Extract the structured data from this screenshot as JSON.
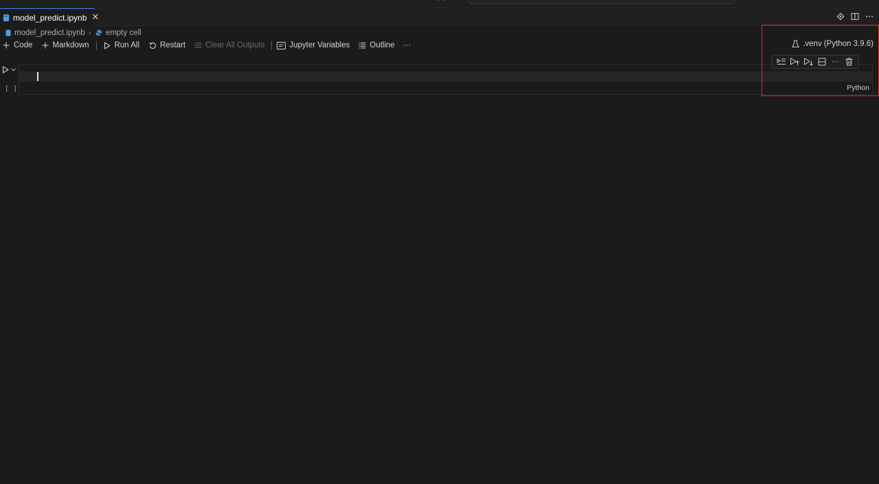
{
  "tab": {
    "label": "model_predict.ipynb",
    "close": "✕"
  },
  "breadcrumb": {
    "file": "model_predict.ipynb",
    "separator": "›",
    "cell": "empty cell"
  },
  "toolbar": {
    "code": "Code",
    "markdown": "Markdown",
    "run_all": "Run All",
    "restart": "Restart",
    "clear_all_outputs": "Clear All Outputs",
    "jupyter_variables": "Jupyter Variables",
    "outline": "Outline",
    "more": "···"
  },
  "kernel": {
    "label": ".venv (Python 3.9.6)"
  },
  "cell": {
    "execution_count": "[ ]",
    "language": "Python",
    "content": ""
  },
  "cell_toolbar": {
    "more": "···"
  },
  "colors": {
    "accent": "#3b82f6",
    "highlight": "#e0302a",
    "background": "#1b1b1b",
    "editor": "#262626"
  }
}
